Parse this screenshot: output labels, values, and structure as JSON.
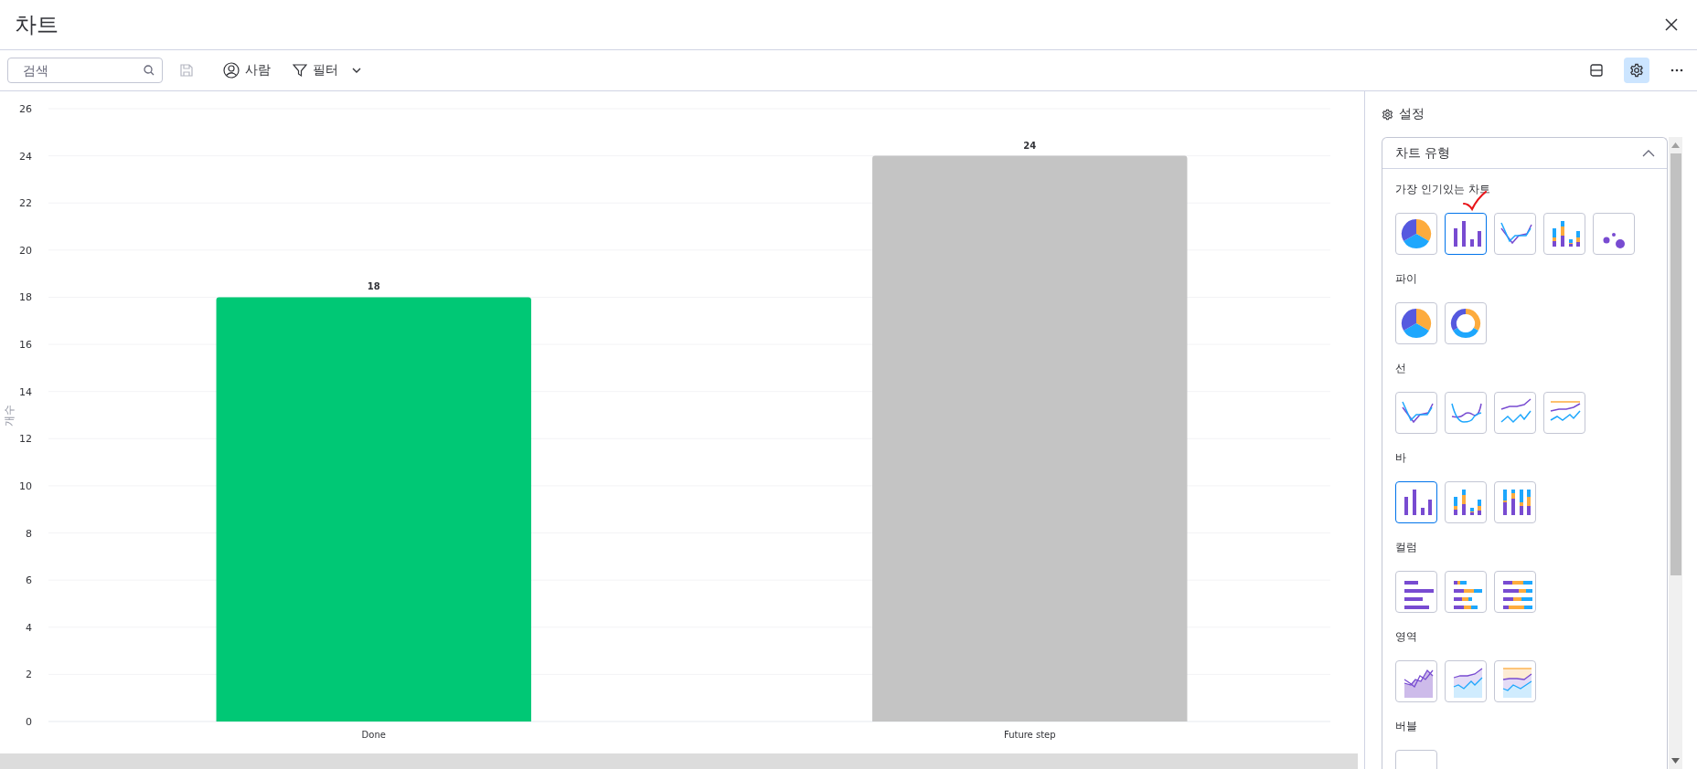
{
  "window": {
    "title": "차트"
  },
  "toolbar": {
    "search": {
      "placeholder": "검색"
    },
    "person_button": "사람",
    "filter_button": "필터"
  },
  "view_buttons": [
    {
      "kind": "layout",
      "selected": false
    },
    {
      "kind": "settings",
      "selected": true
    },
    {
      "kind": "more",
      "selected": false
    }
  ],
  "chart": {
    "chart_data": {
      "type": "bar",
      "ylabel": "개수",
      "categories": [
        "Done",
        "Future step"
      ],
      "values": [
        18,
        24
      ],
      "colors": [
        "#00c875",
        "#c4c4c4"
      ],
      "ylim": [
        0,
        26
      ],
      "yticks": [
        0,
        2,
        4,
        6,
        8,
        10,
        12,
        14,
        16,
        18,
        20,
        22,
        24,
        26
      ],
      "data_labels": true,
      "grid": true
    }
  },
  "settings_panel": {
    "title": "설정",
    "section": {
      "title": "차트 유형",
      "expanded": true,
      "groups": [
        {
          "label": "가장 인기있는 차트",
          "options": [
            {
              "kind": "pie",
              "selected": false
            },
            {
              "kind": "bar",
              "selected": true
            },
            {
              "kind": "line",
              "selected": false
            },
            {
              "kind": "stacked-bar",
              "selected": false
            },
            {
              "kind": "bubble",
              "selected": false
            }
          ]
        },
        {
          "label": "파이",
          "options": [
            {
              "kind": "pie",
              "selected": false
            },
            {
              "kind": "donut",
              "selected": false
            }
          ]
        },
        {
          "label": "선",
          "options": [
            {
              "kind": "line",
              "selected": false
            },
            {
              "kind": "smooth-line",
              "selected": false
            },
            {
              "kind": "stacked-line",
              "selected": false
            },
            {
              "kind": "full-line",
              "selected": false
            }
          ]
        },
        {
          "label": "바",
          "options": [
            {
              "kind": "bar",
              "selected": true
            },
            {
              "kind": "stacked-bar",
              "selected": false
            },
            {
              "kind": "full-bar",
              "selected": false
            }
          ]
        },
        {
          "label": "컬럼",
          "options": [
            {
              "kind": "column",
              "selected": false
            },
            {
              "kind": "stacked-column",
              "selected": false
            },
            {
              "kind": "full-column",
              "selected": false
            }
          ]
        },
        {
          "label": "영역",
          "options": [
            {
              "kind": "area",
              "selected": false
            },
            {
              "kind": "stacked-area",
              "selected": false
            },
            {
              "kind": "full-area",
              "selected": false
            }
          ]
        },
        {
          "label": "버블",
          "options": [
            {
              "selected": false
            }
          ]
        }
      ]
    }
  }
}
